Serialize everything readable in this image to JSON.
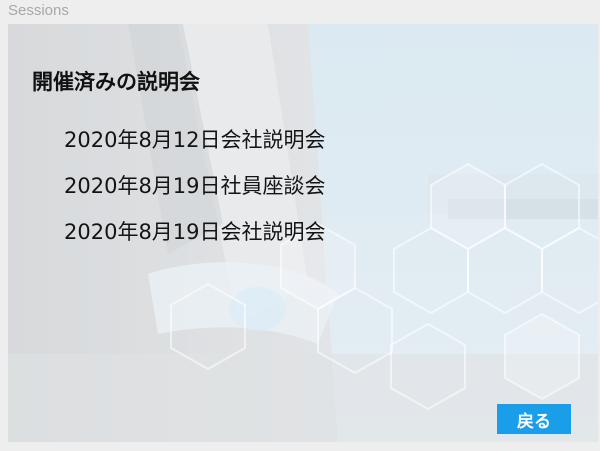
{
  "window": {
    "title": "Sessions"
  },
  "main": {
    "heading": "開催済みの説明会",
    "sessions": [
      "2020年8月12日会社説明会",
      "2020年8月19日社員座談会",
      "2020年8月19日会社説明会"
    ],
    "back_label": "戻る"
  },
  "colors": {
    "accent": "#1a9ee9",
    "page_background": "#eeeeee",
    "title_text": "#a8a8a8"
  }
}
